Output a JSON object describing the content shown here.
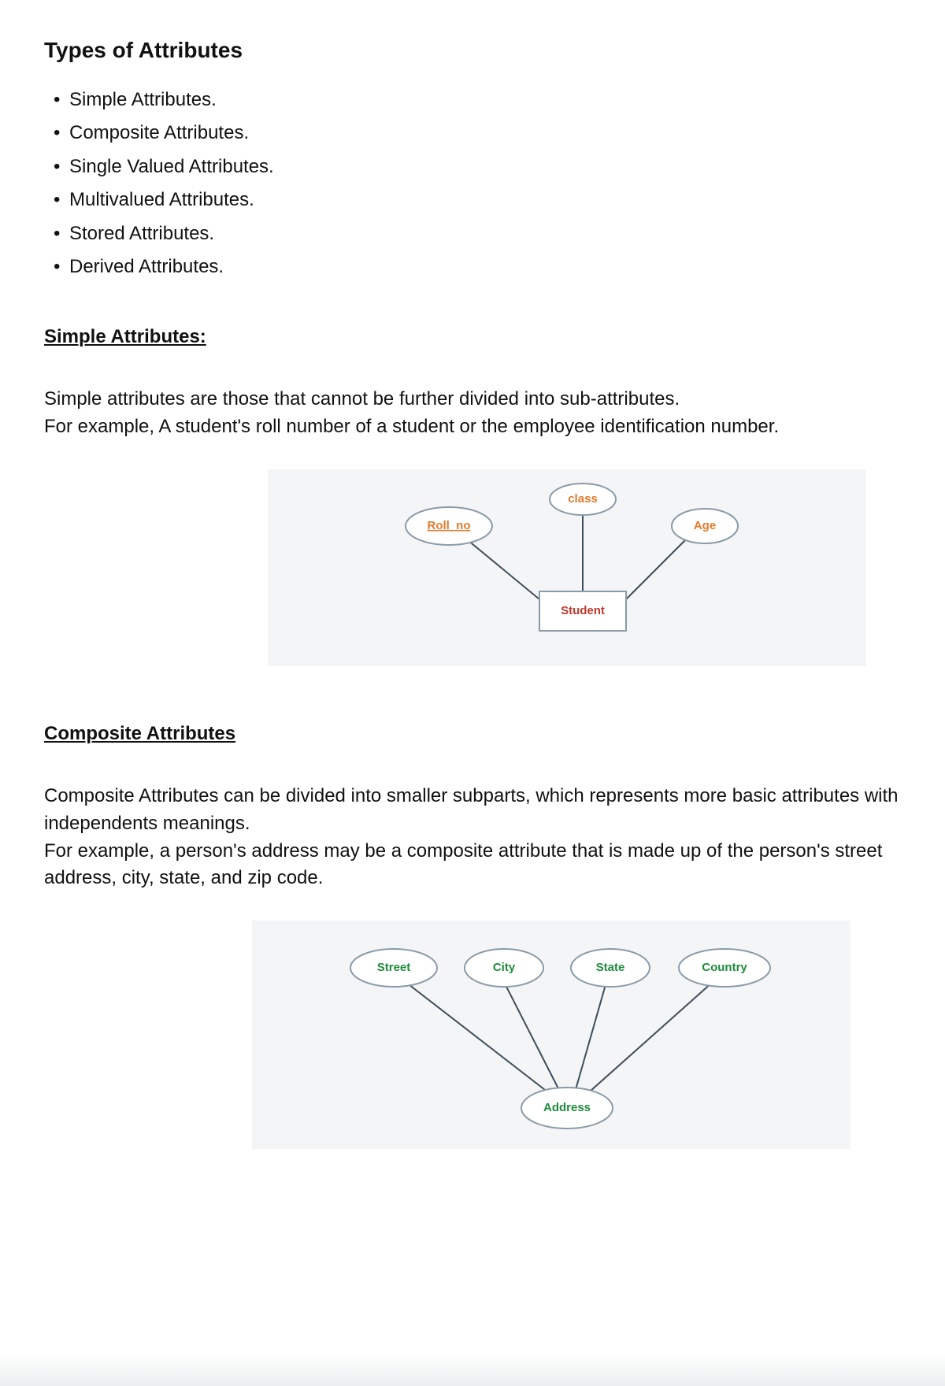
{
  "title": "Types of Attributes",
  "bullets": [
    "Simple Attributes.",
    "Composite Attributes.",
    "Single Valued Attributes.",
    "Multivalued Attributes.",
    "Stored Attributes.",
    "Derived Attributes."
  ],
  "simple": {
    "heading": " Simple Attributes:",
    "para1": "Simple attributes are those that cannot be further divided into sub-attributes.",
    "para2": "For example, A student's roll number of a student or the employee identification number.",
    "diagram": {
      "entity": "Student",
      "attrs": {
        "roll_no": "Roll_no",
        "class": "class",
        "age": "Age"
      }
    }
  },
  "composite": {
    "heading": "Composite Attributes",
    "para1": "Composite Attributes can be divided into smaller subparts, which represents more basic attributes with independents meanings.",
    "para2": "For example, a person's address may be a composite attribute that is made up of the person's street address, city, state, and zip code.",
    "diagram": {
      "root": "Address",
      "parts": {
        "street": "Street",
        "city": "City",
        "state": "State",
        "country": "Country"
      }
    }
  }
}
